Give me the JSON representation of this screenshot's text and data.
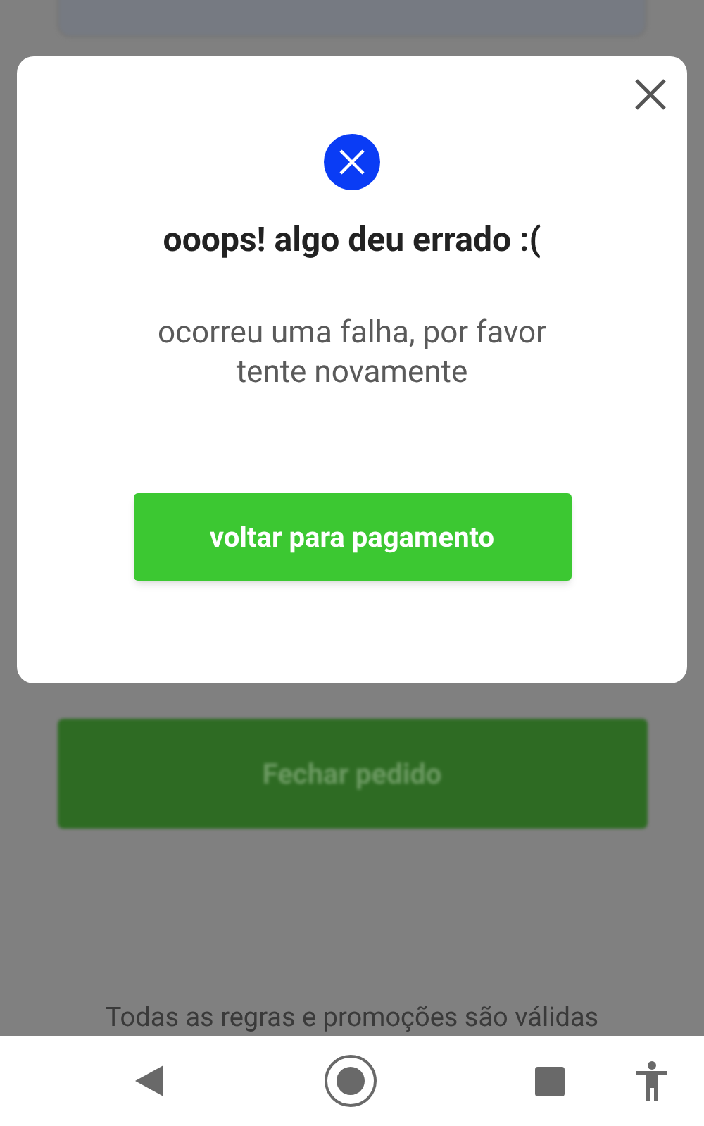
{
  "background": {
    "order_button": "Fechar pedido",
    "footer_text": "Todas as regras e promoções são válidas"
  },
  "dialog": {
    "title": "ooops! algo deu errado :(",
    "message": "ocorreu uma falha, por favor tente novamente",
    "button": "voltar para pagamento"
  }
}
